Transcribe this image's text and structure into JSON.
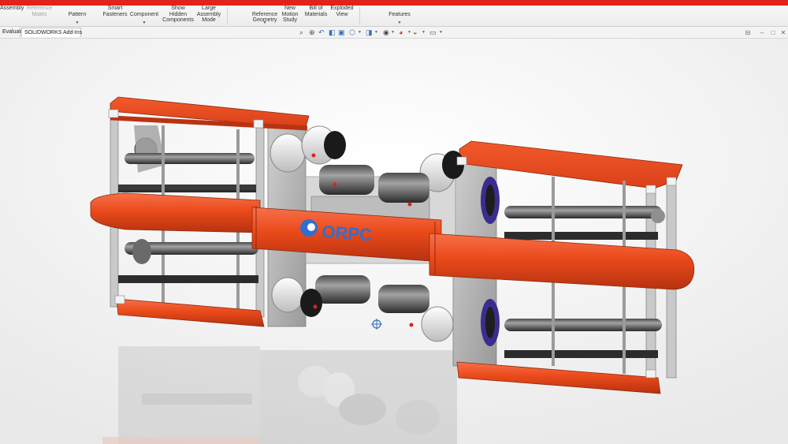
{
  "ribbon": {
    "features": "Features",
    "explode_view": "Exploded\nView",
    "bill_materials": "Bill of\nMaterials",
    "motion_study": "New\nMotion\nStudy",
    "reference_geometry": "Reference\nGeometry",
    "large_assembly_mode": "Large\nAssembly\nMode",
    "show_hidden": "Show\nHidden\nComponents",
    "new_component": "Component",
    "smart_fasteners": "Smart\nFasteners",
    "pattern": "Pattern",
    "reference_dim": "Reference\nMates",
    "assembly_features": "Assembly"
  },
  "tabs": [
    {
      "label": "Evaluate"
    },
    {
      "label": "SOLIDWORKS Add-Ins"
    }
  ],
  "model": {
    "logo_text": "ORPC"
  },
  "colors": {
    "accent": "#e2231a",
    "panel_orange": "#ee4d1c",
    "frame": "#d6d6d6",
    "logo_blue": "#2f6fd0"
  }
}
